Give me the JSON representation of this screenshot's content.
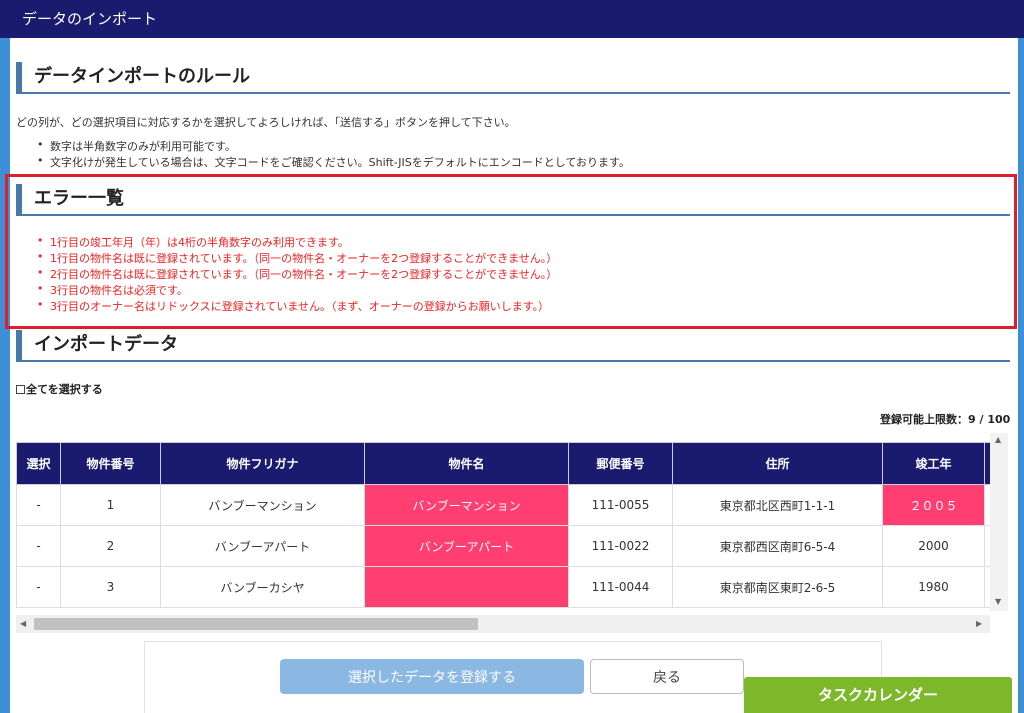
{
  "titlebar": {
    "title": "データのインポート"
  },
  "rules": {
    "heading": "データインポートのルール",
    "intro": "どの列が、どの選択項目に対応するかを選択してよろしければ、「送信する」ボタンを押して下さい。",
    "items": [
      "数字は半角数字のみが利用可能です。",
      "文字化けが発生している場合は、文字コードをご確認ください。Shift-JISをデフォルトにエンコードとしております。"
    ]
  },
  "errors": {
    "heading": "エラー一覧",
    "items": [
      "1行目の竣工年月（年）は4桁の半角数字のみ利用できます。",
      "1行目の物件名は既に登録されています。（同一の物件名・オーナーを2つ登録することができません。）",
      "2行目の物件名は既に登録されています。（同一の物件名・オーナーを2つ登録することができません。）",
      "3行目の物件名は必須です。",
      "3行目のオーナー名はリドックスに登録されていません。（まず、オーナーの登録からお願いします。）"
    ]
  },
  "import": {
    "heading": "インポートデータ",
    "select_all": "全てを選択する",
    "limit_text": "登録可能上限数：9 / 100"
  },
  "table": {
    "columns": [
      "選択",
      "物件番号",
      "物件フリガナ",
      "物件名",
      "郵便番号",
      "住所",
      "竣工年"
    ],
    "rows": [
      [
        "-",
        "1",
        "バンブーマンション",
        "バンブーマンション",
        "111-0055",
        "東京都北区西町1-1-1",
        "２００５"
      ],
      [
        "-",
        "2",
        "バンブーアパート",
        "バンブーアパート",
        "111-0022",
        "東京都西区南町6-5-4",
        "2000"
      ],
      [
        "-",
        "3",
        "バンブーカシヤ",
        "",
        "111-0044",
        "東京都南区東町2-6-5",
        "1980"
      ]
    ]
  },
  "buttons": {
    "register": "選択したデータを登録する",
    "back": "戻る"
  },
  "task_calendar": "タスクカレンダー",
  "colors": {
    "header": "#1a1a6e",
    "error": "#e22222",
    "error_cell": "#ff3f72",
    "accent": "#4a78a8",
    "task": "#7db82a"
  }
}
